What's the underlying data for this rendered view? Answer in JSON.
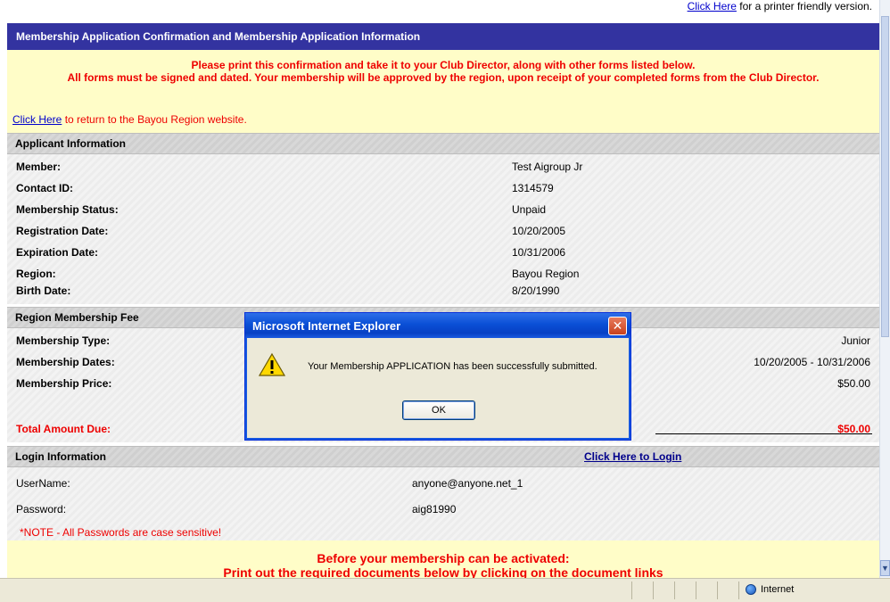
{
  "printer": {
    "link": "Click Here",
    "text": "for a printer friendly version."
  },
  "header": {
    "title": "Membership Application Confirmation and Membership Application Information"
  },
  "notice": {
    "line1": "Please print this confirmation and take it to your Club Director, along with other forms listed below.",
    "line2": "All forms must be signed and dated. Your membership will be approved by the region, upon receipt of your completed forms from the Club Director.",
    "return_link": "Click Here",
    "return_text": "to return to the Bayou Region website."
  },
  "applicant": {
    "heading": "Applicant Information",
    "rows": [
      {
        "label": "Member:",
        "value": "Test Aigroup Jr"
      },
      {
        "label": "Contact ID:",
        "value": "1314579"
      },
      {
        "label": "Membership Status:",
        "value": "Unpaid"
      },
      {
        "label": "Registration Date:",
        "value": "10/20/2005"
      },
      {
        "label": "Expiration Date:",
        "value": "10/31/2006"
      },
      {
        "label": "Region:",
        "value": "Bayou Region"
      },
      {
        "label": "Birth Date:",
        "value": "8/20/1990"
      }
    ]
  },
  "fee": {
    "heading": "Region Membership Fee",
    "type_label": "Membership Type:",
    "type_value": "Junior",
    "dates_label": "Membership Dates:",
    "dates_value": "10/20/2005 - 10/31/2006",
    "price_label": "Membership Price:",
    "price_value": "$50.00",
    "total_label": "Total Amount Due:",
    "total_value": "$50.00"
  },
  "login": {
    "heading": "Login Information",
    "login_link": "Click Here to Login",
    "username_label": "UserName:",
    "username_value": "anyone@anyone.net_1",
    "password_label": "Password:",
    "password_value": "aig81990",
    "note": "*NOTE - All Passwords are case sensitive!"
  },
  "before": {
    "line1": "Before your membership can be activated:",
    "line2": "Print out the required documents below by clicking on the document links"
  },
  "dialog": {
    "title": "Microsoft Internet Explorer",
    "message": "Your Membership APPLICATION has been successfully submitted.",
    "ok": "OK",
    "close_glyph": "✕"
  },
  "statusbar": {
    "zone": "Internet"
  },
  "colors": {
    "header_bg": "#3333a0",
    "notice_bg": "#fffdc8",
    "alert_red": "#ee0000",
    "link": "#0000cc"
  }
}
